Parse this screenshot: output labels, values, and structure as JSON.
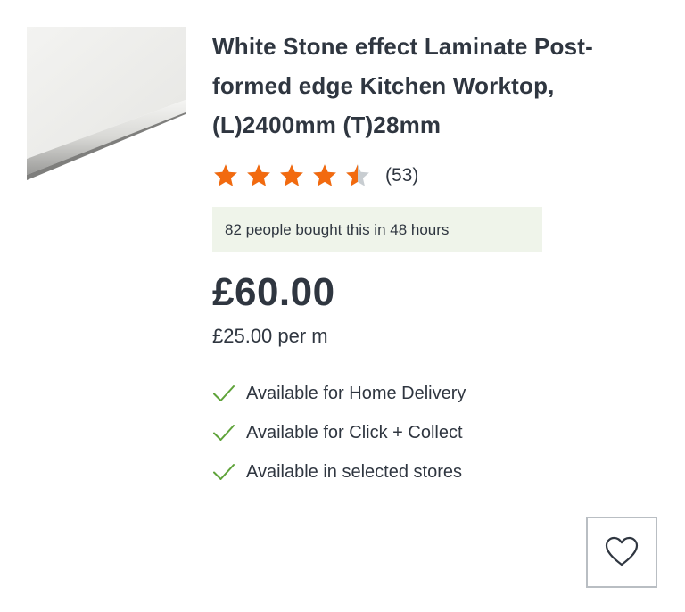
{
  "product": {
    "title": "White Stone effect Laminate Post-formed edge Kitchen Worktop, (L)2400mm (T)28mm",
    "image_icon": "worktop-thumbnail",
    "rating": {
      "value": 4.5,
      "max": 5,
      "count_label": "(53)"
    },
    "social_proof": "82 people bought this in 48 hours",
    "price": "£60.00",
    "unit_price": "£25.00 per m",
    "availability": [
      {
        "icon": "check-icon",
        "label": "Available for Home Delivery"
      },
      {
        "icon": "check-icon",
        "label": "Available for Click + Collect"
      },
      {
        "icon": "check-icon",
        "label": "Available in selected stores"
      }
    ]
  },
  "wishlist": {
    "icon": "heart-icon"
  },
  "colors": {
    "star": "#f26a0f",
    "star_empty": "#c8cdd1",
    "check": "#5fa33a",
    "banner_bg": "#eff4ea",
    "text": "#2f3640"
  }
}
